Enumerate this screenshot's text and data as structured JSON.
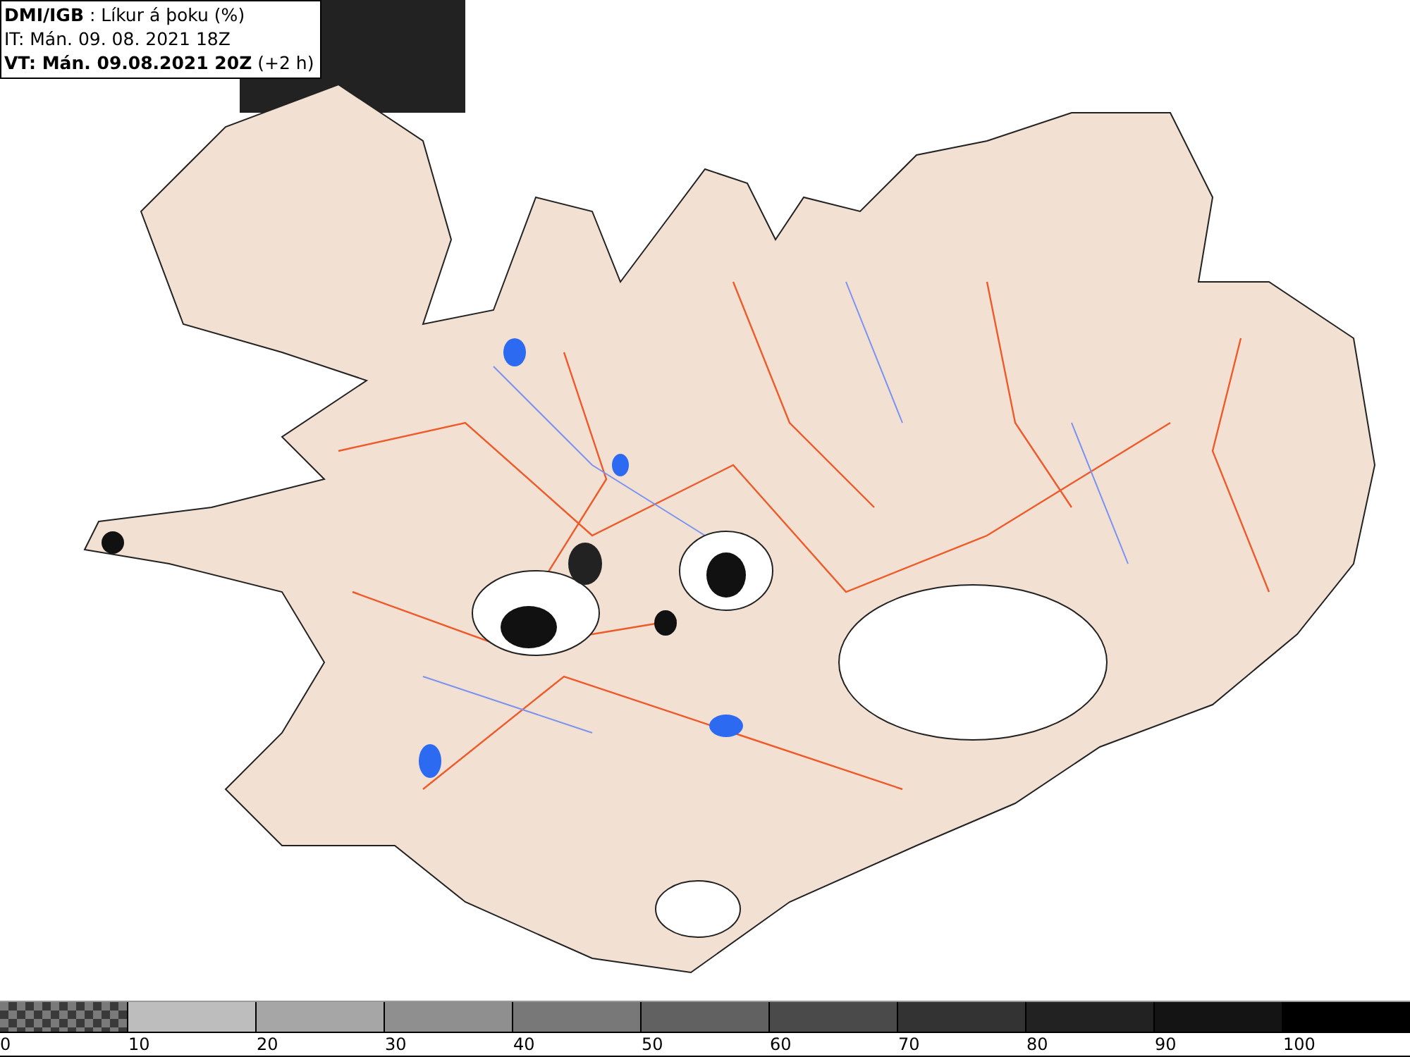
{
  "header": {
    "lines": [
      "**DMI/IGB** : Líkur á þoku (%)",
      "IT: Mán. 09. 08. 2021 18Z",
      "**VT: Mán. 09.08.2021 20Z** (+2 h)"
    ]
  },
  "legend": {
    "segments": [
      {
        "kind": "checker",
        "color": "#6e6e6e"
      },
      {
        "kind": "solid",
        "color": "#bdbdbd"
      },
      {
        "kind": "solid",
        "color": "#a6a6a6"
      },
      {
        "kind": "solid",
        "color": "#8f8f8f"
      },
      {
        "kind": "solid",
        "color": "#787878"
      },
      {
        "kind": "solid",
        "color": "#616161"
      },
      {
        "kind": "solid",
        "color": "#4a4a4a"
      },
      {
        "kind": "solid",
        "color": "#333333"
      },
      {
        "kind": "solid",
        "color": "#222222"
      },
      {
        "kind": "solid",
        "color": "#141414"
      },
      {
        "kind": "solid",
        "color": "#000000"
      }
    ],
    "labels": [
      "0",
      "10",
      "20",
      "30",
      "40",
      "50",
      "60",
      "70",
      "80",
      "90",
      "100"
    ]
  }
}
